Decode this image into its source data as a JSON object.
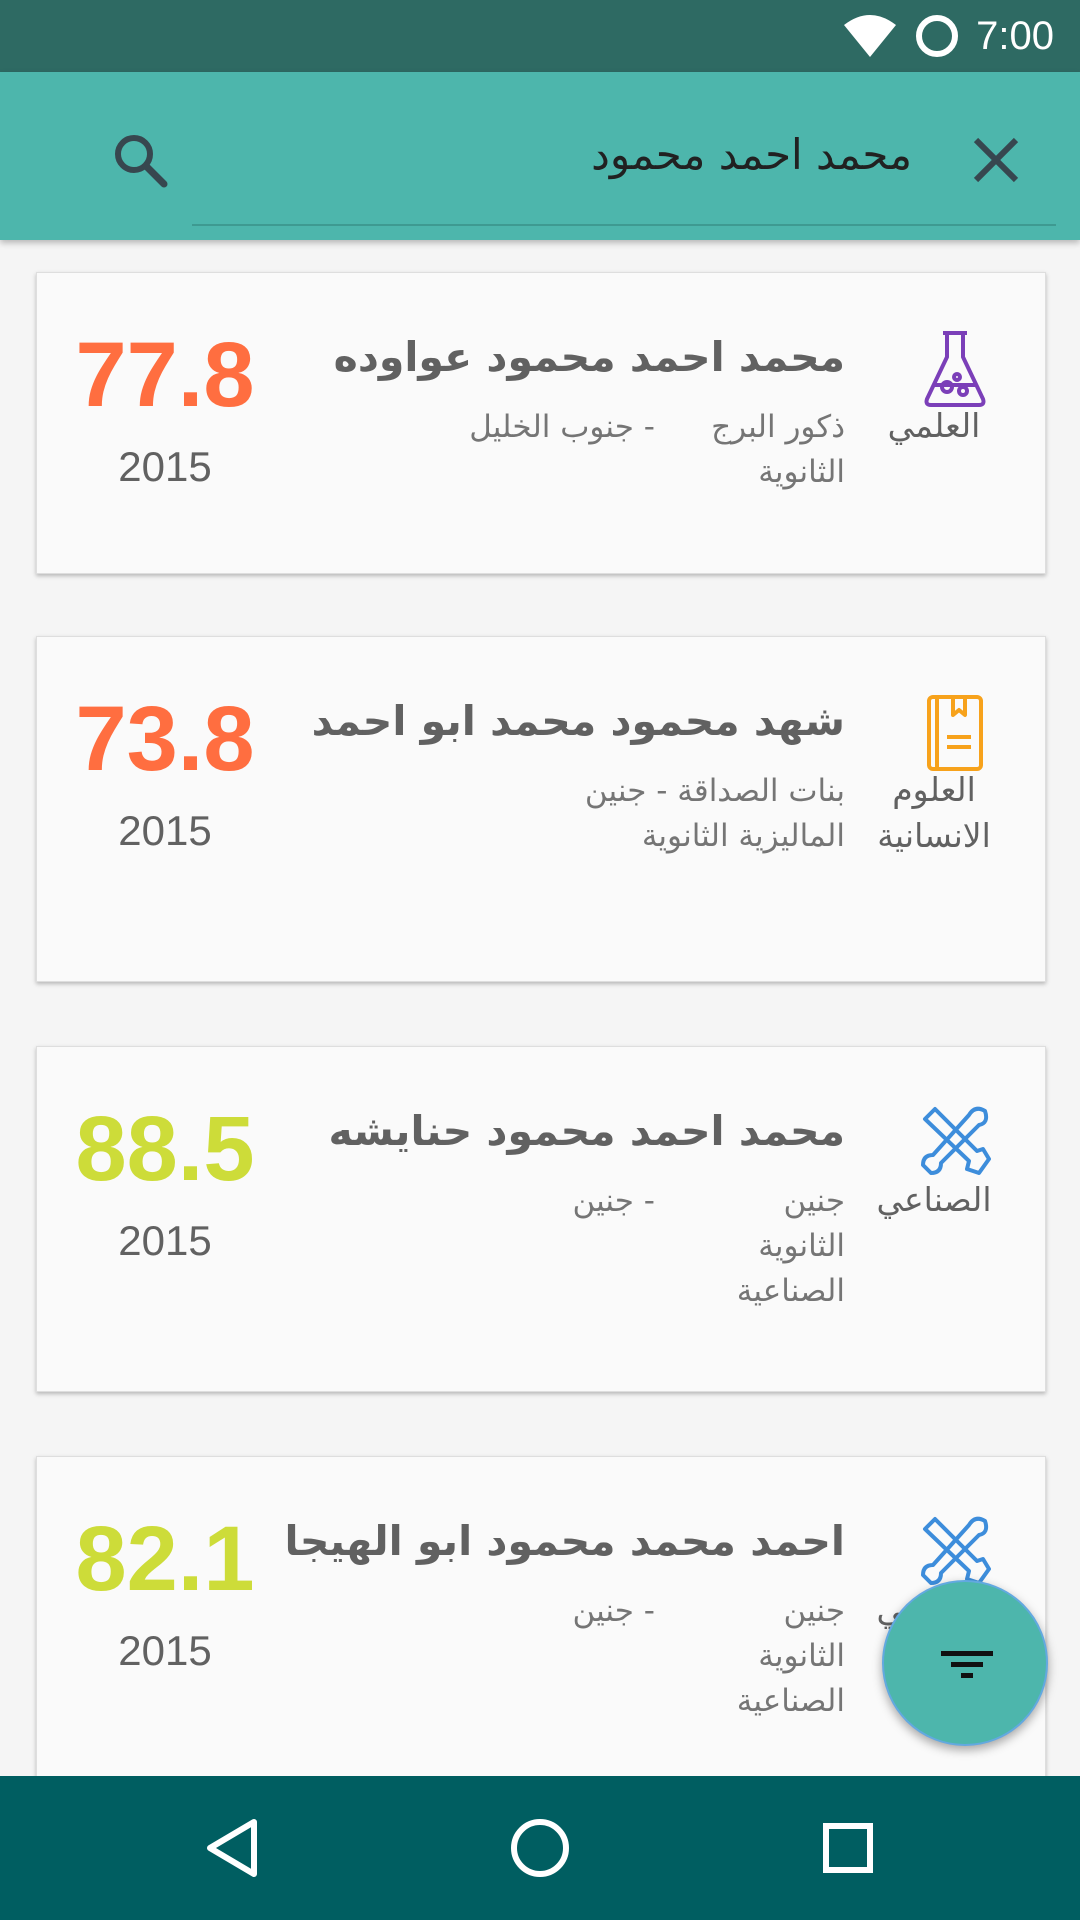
{
  "status_bar": {
    "time": "7:00"
  },
  "search": {
    "query": "محمد احمد محمود"
  },
  "results": [
    {
      "branch": "العلمي",
      "branch_icon": "flask-icon",
      "icon_color": "#7b3fb8",
      "name": "محمد احمد محمود عواوده",
      "school": "ذكور البرج الثانوية",
      "district": "- جنوب الخليل",
      "score": "77.8",
      "score_color": "#ff6e40",
      "year": "2015"
    },
    {
      "branch": "العلوم الانسانية",
      "branch_icon": "book-icon",
      "icon_color": "#f7a21b",
      "name": "شهد محمود محمد ابو احمد",
      "school": "بنات الصداقة - جنين الماليزية الثانوية",
      "district": "",
      "score": "73.8",
      "score_color": "#ff6e40",
      "year": "2015"
    },
    {
      "branch": "الصناعي",
      "branch_icon": "tools-icon",
      "icon_color": "#3d8ddb",
      "name": "محمد احمد محمود حنايشه",
      "school": "جنين الثانوية الصناعية",
      "district": "- جنين",
      "score": "88.5",
      "score_color": "#cddc39",
      "year": "2015"
    },
    {
      "branch": "الصناعي",
      "branch_icon": "tools-icon",
      "icon_color": "#3d8ddb",
      "name": "احمد محمد محمود ابو الهيجا",
      "school": "جنين الثانوية الصناعية",
      "district": "- جنين",
      "score": "82.1",
      "score_color": "#cddc39",
      "year": "2015"
    }
  ],
  "fab": {
    "icon": "filter-icon"
  },
  "nav": {
    "back_icon": "back-triangle-icon",
    "home_icon": "home-circle-icon",
    "recents_icon": "recents-square-icon"
  }
}
